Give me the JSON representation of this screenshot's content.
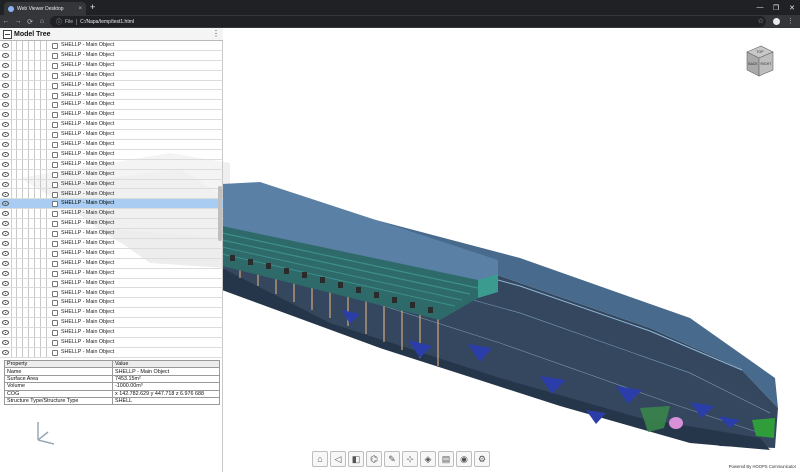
{
  "browser": {
    "tab_title": "Web Viewer Desktop",
    "tab_close_glyph": "×",
    "new_tab_glyph": "+",
    "window_controls": [
      "—",
      "❐",
      "✕"
    ],
    "nav": {
      "back": "←",
      "forward": "→",
      "reload": "⟳",
      "home": "⌂"
    },
    "url_scheme": "File",
    "url": "C:/Napa/temp/test1.html",
    "star_glyph": "☆",
    "menu_glyph": "⋮"
  },
  "model_tree": {
    "title": "Model Tree",
    "menu_glyph": "⋮",
    "row_label": "SHELLP - Main Object",
    "rows": [
      "SHELLP - Main Object",
      "SHELLP - Main Object",
      "SHELLP - Main Object",
      "SHELLP - Main Object",
      "SHELLP - Main Object",
      "SHELLP - Main Object",
      "SHELLP - Main Object",
      "SHELLP - Main Object",
      "SHELLP - Main Object",
      "SHELLP - Main Object",
      "SHELLP - Main Object",
      "SHELLP - Main Object",
      "SHELLP - Main Object",
      "SHELLP - Main Object",
      "SHELLP - Main Object",
      "SHELLP - Main Object",
      "SHELLP - Main Object",
      "SHELLP - Main Object",
      "SHELLP - Main Object",
      "SHELLP - Main Object",
      "SHELLP - Main Object",
      "SHELLP - Main Object",
      "SHELLP - Main Object",
      "SHELLP - Main Object",
      "SHELLP - Main Object",
      "SHELLP - Main Object",
      "SHELLP - Main Object",
      "SHELLP - Main Object",
      "SHELLP - Main Object",
      "SHELLP - Main Object",
      "SHELLP - Main Object",
      "SHELLP - Main Object"
    ],
    "selected_index": 16
  },
  "properties": {
    "headers": [
      "Property",
      "Value"
    ],
    "rows": [
      [
        "Name",
        "SHELLP - Main Object"
      ],
      [
        "Surface Area",
        "7453.15m²"
      ],
      [
        "Volume",
        "-1000.00m³"
      ],
      [
        "COG",
        "x 142.782.629 y 447.718 z 6.976 688"
      ],
      [
        "Structure Type/Structure Type",
        "SHELL"
      ]
    ]
  },
  "navcube": {
    "faces": [
      "TOP",
      "BACK",
      "RIGHT"
    ]
  },
  "toolbar": {
    "buttons": [
      {
        "name": "home-button",
        "glyph": "⌂"
      },
      {
        "name": "camera-view-button",
        "glyph": "◁"
      },
      {
        "name": "draw-mode-button",
        "glyph": "◧"
      },
      {
        "name": "explode-button",
        "glyph": "⌬"
      },
      {
        "name": "markup-button",
        "glyph": "✎"
      },
      {
        "name": "measure-button",
        "glyph": "⊹"
      },
      {
        "name": "cutting-plane-button",
        "glyph": "◈"
      },
      {
        "name": "model-browser-button",
        "glyph": "▤"
      },
      {
        "name": "snapshot-button",
        "glyph": "◉"
      },
      {
        "name": "settings-button",
        "glyph": "⚙"
      }
    ]
  },
  "credit": "Powered By HOOPS Communicator",
  "colors": {
    "hull": "#3c5a78",
    "deck": "#4d6f8f",
    "superstructure_top": "#5b82a8",
    "accent_green": "#2e7d5a",
    "selection": "#a9cdf2"
  }
}
